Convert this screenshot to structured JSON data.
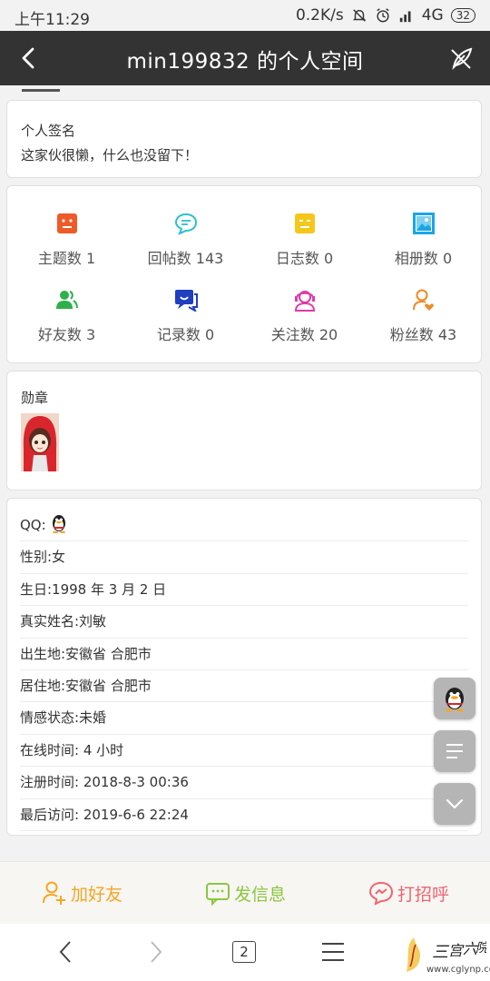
{
  "status_bar": {
    "time": "上午11:29",
    "network_speed": "0.2K/s",
    "network_type": "4G",
    "battery": "32"
  },
  "header": {
    "title": "min199832 的个人空间",
    "back_icon": "chevron-left-icon",
    "action_icon": "feather-pen-icon"
  },
  "signature": {
    "label": "个人签名",
    "text": "这家伙很懒，什么也没留下！"
  },
  "stats": [
    {
      "label": "主题数 1",
      "icon": "topic-icon",
      "color": "#f05a28"
    },
    {
      "label": "回帖数 143",
      "icon": "chat-bubble-icon",
      "color": "#2bc1c9"
    },
    {
      "label": "日志数 0",
      "icon": "diary-icon",
      "color": "#f5c71a"
    },
    {
      "label": "相册数 0",
      "icon": "photo-icon",
      "color": "#1aa6e6"
    },
    {
      "label": "好友数 3",
      "icon": "friends-icon",
      "color": "#2eb04a"
    },
    {
      "label": "记录数 0",
      "icon": "record-icon",
      "color": "#1f3fbf"
    },
    {
      "label": "关注数 20",
      "icon": "headset-icon",
      "color": "#e23aa7"
    },
    {
      "label": "粉丝数 43",
      "icon": "fan-heart-icon",
      "color": "#f08a24"
    }
  ],
  "medal": {
    "label": "勋章",
    "badge_icon": "red-hood-girl-badge-icon"
  },
  "profile": {
    "qq_label": "QQ:",
    "rows": [
      "性别:女",
      "生日:1998 年 3 月 2 日",
      "真实姓名:刘敏",
      "出生地:安徽省 合肥市",
      "居住地:安徽省 合肥市",
      "情感状态:未婚",
      "在线时间: 4 小时",
      "注册时间: 2018-8-3 00:36",
      "最后访问: 2019-6-6 22:24"
    ]
  },
  "bottom_actions": {
    "add_friend": "加好友",
    "send_message": "发信息",
    "greet": "打招呼",
    "colors": {
      "add_friend": "#f5a623",
      "send_message": "#8cc63f",
      "greet": "#f06470"
    }
  },
  "browser_nav": {
    "tab_count": "2"
  },
  "watermark": {
    "site": "www.cglynp.com"
  }
}
